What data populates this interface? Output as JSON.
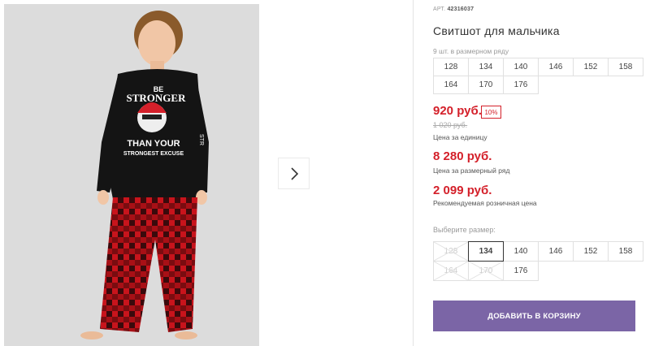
{
  "product": {
    "sku_label": "АРТ.",
    "sku": "42316037",
    "title": "Свитшот для мальчика",
    "image_alt": "Мальчик в свитшоте и клетчатых брюках"
  },
  "size_row": {
    "note": "9 шт. в размерном ряду",
    "sizes": [
      "128",
      "134",
      "140",
      "146",
      "152",
      "158",
      "164",
      "170",
      "176"
    ]
  },
  "pricing": {
    "price": "920 руб.",
    "discount": "10%",
    "old_price": "1 020 руб.",
    "unit_label": "Цена за единицу",
    "row_price": "8 280 руб.",
    "row_label": "Цена за размерный ряд",
    "recommended_price": "2 099 руб.",
    "recommended_label": "Рекомендуемая розничная цена"
  },
  "size_picker": {
    "label": "Выберите размер:",
    "selected": "134",
    "options": [
      {
        "size": "128",
        "available": false
      },
      {
        "size": "134",
        "available": true
      },
      {
        "size": "140",
        "available": true
      },
      {
        "size": "146",
        "available": true
      },
      {
        "size": "152",
        "available": true
      },
      {
        "size": "158",
        "available": true
      },
      {
        "size": "164",
        "available": false
      },
      {
        "size": "170",
        "available": false
      },
      {
        "size": "176",
        "available": true
      }
    ]
  },
  "cart": {
    "button_label": "ДОБАВИТЬ В КОРЗИНУ"
  },
  "gallery": {
    "next_icon": "chevron-right-icon"
  },
  "print": {
    "line1": "BE",
    "line2": "STRONGER",
    "line3": "THAN YOUR",
    "line4": "STRONGEST EXCUSE",
    "sleeve": "STR"
  },
  "colors": {
    "accent": "#d4202a",
    "button": "#7b65a6"
  }
}
